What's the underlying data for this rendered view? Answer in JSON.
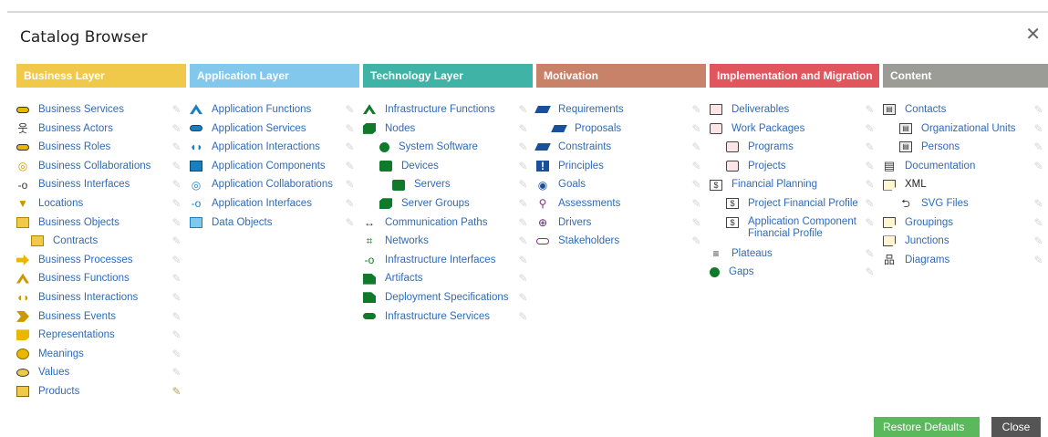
{
  "dialog": {
    "title": "Catalog Browser",
    "close_glyph": "✕"
  },
  "buttons": {
    "restore": "Restore Defaults",
    "close": "Close"
  },
  "columns": [
    {
      "header": "Business Layer",
      "color": "#f0c94a"
    },
    {
      "header": "Application Layer",
      "color": "#82c7ec"
    },
    {
      "header": "Technology Layer",
      "color": "#3fb3a5"
    },
    {
      "header": "Motivation",
      "color": "#c9826a"
    },
    {
      "header": "Implementation and Migration",
      "color": "#e1555d"
    },
    {
      "header": "Content",
      "color": "#9a9c95"
    }
  ],
  "business": [
    "Business Services",
    "Business Actors",
    "Business Roles",
    "Business Collaborations",
    "Business Interfaces",
    "Locations",
    "Business Objects",
    "Contracts",
    "Business Processes",
    "Business Functions",
    "Business Interactions",
    "Business Events",
    "Representations",
    "Meanings",
    "Values",
    "Products"
  ],
  "application": [
    "Application Functions",
    "Application Services",
    "Application Interactions",
    "Application Components",
    "Application Collaborations",
    "Application Interfaces",
    "Data Objects"
  ],
  "technology": [
    "Infrastructure Functions",
    "Nodes",
    "System Software",
    "Devices",
    "Servers",
    "Server Groups",
    "Communication Paths",
    "Networks",
    "Infrastructure Interfaces",
    "Artifacts",
    "Deployment Specifications",
    "Infrastructure Services"
  ],
  "motivation": [
    "Requirements",
    "Proposals",
    "Constraints",
    "Principles",
    "Goals",
    "Assessments",
    "Drivers",
    "Stakeholders"
  ],
  "implementation": [
    "Deliverables",
    "Work Packages",
    "Programs",
    "Projects",
    "Financial Planning",
    "Project Financial Profile",
    "Application Component Financial Profile",
    "Plateaus",
    "Gaps"
  ],
  "content": [
    "Contacts",
    "Organizational Units",
    "Persons",
    "Documentation",
    "XML",
    "SVG Files",
    "Groupings",
    "Junctions",
    "Diagrams"
  ],
  "icons": {
    "pin": "✎"
  }
}
